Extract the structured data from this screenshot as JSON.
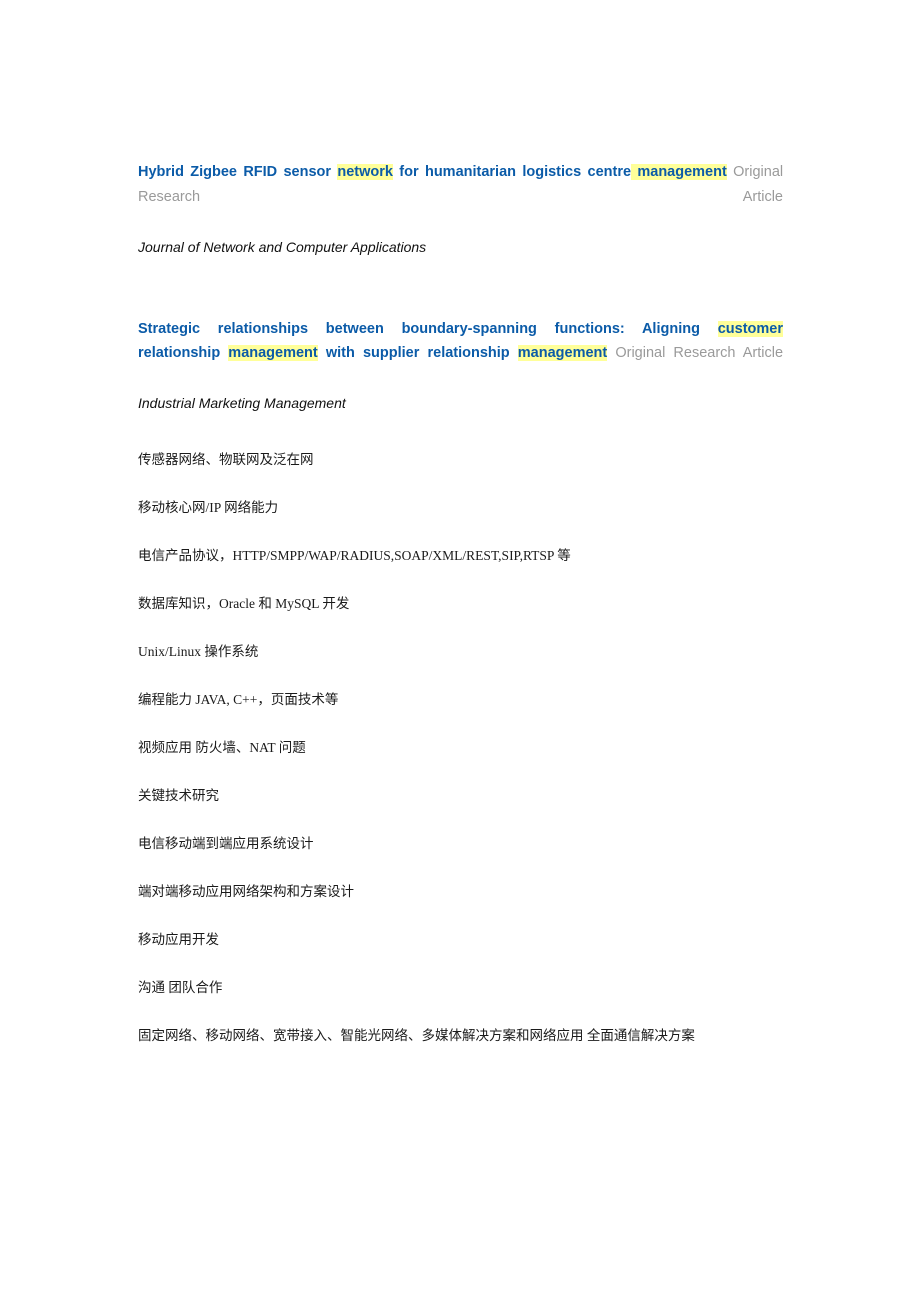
{
  "document": {
    "page_background": "#ffffff",
    "link_color": "#0b5ba8",
    "highlight_color": "#ffff99",
    "muted_color": "#9a9a9a"
  },
  "references": [
    {
      "title_parts": [
        {
          "text": "Hybrid",
          "highlight": false
        },
        {
          "text": " ",
          "highlight": false
        },
        {
          "text": "Zigbee",
          "highlight": false
        },
        {
          "text": " ",
          "highlight": false
        },
        {
          "text": "RFID",
          "highlight": false
        },
        {
          "text": " ",
          "highlight": false
        },
        {
          "text": "sensor",
          "highlight": false
        },
        {
          "text": " ",
          "highlight": false
        },
        {
          "text": "network",
          "highlight": true
        },
        {
          "text": " ",
          "highlight": false
        },
        {
          "text": "for",
          "highlight": false
        },
        {
          "text": " ",
          "highlight": false
        },
        {
          "text": "humanitarian",
          "highlight": false
        },
        {
          "text": " ",
          "highlight": false
        },
        {
          "text": "logistics",
          "highlight": false
        },
        {
          "text": " ",
          "highlight": false
        },
        {
          "text": "centre",
          "highlight": false
        },
        {
          "text": " ",
          "highlight": true
        },
        {
          "text": "management",
          "highlight": true
        }
      ],
      "title_plain": "Hybrid Zigbee RFID sensor network for humanitarian logistics centre management",
      "article_type": "Original Research Article",
      "journal": "Journal of Network and Computer Applications"
    },
    {
      "title_parts": [
        {
          "text": "Strategic relationships between boundary-spanning functions: Aligning",
          "highlight": false
        },
        {
          "text": " ",
          "highlight": false
        },
        {
          "text": "customer",
          "highlight": true
        },
        {
          "text": " ",
          "highlight": false
        },
        {
          "text": "relationship",
          "highlight": false
        },
        {
          "text": " ",
          "highlight": false
        },
        {
          "text": "management",
          "highlight": true
        },
        {
          "text": " ",
          "highlight": false
        },
        {
          "text": "with",
          "highlight": false
        },
        {
          "text": " ",
          "highlight": false
        },
        {
          "text": "supplier",
          "highlight": false
        },
        {
          "text": " ",
          "highlight": false
        },
        {
          "text": "relationship",
          "highlight": false
        },
        {
          "text": " ",
          "highlight": false
        },
        {
          "text": "management",
          "highlight": true
        }
      ],
      "title_plain": "Strategic relationships between boundary-spanning functions: Aligning customer relationship management with supplier relationship management",
      "article_type": "Original Research Article",
      "journal": "Industrial Marketing Management"
    }
  ],
  "skills": [
    "传感器网络、物联网及泛在网",
    "移动核心网/IP 网络能力",
    "电信产品协议，HTTP/SMPP/WAP/RADIUS,SOAP/XML/REST,SIP,RTSP 等",
    "数据库知识，Oracle 和 MySQL 开发",
    "Unix/Linux 操作系统",
    "编程能力 JAVA, C++，页面技术等",
    "视频应用 防火墙、NAT 问题",
    "关键技术研究",
    "电信移动端到端应用系统设计",
    "端对端移动应用网络架构和方案设计",
    "移动应用开发",
    "沟通 团队合作",
    "固定网络、移动网络、宽带接入、智能光网络、多媒体解决方案和网络应用 全面通信解决方案"
  ]
}
